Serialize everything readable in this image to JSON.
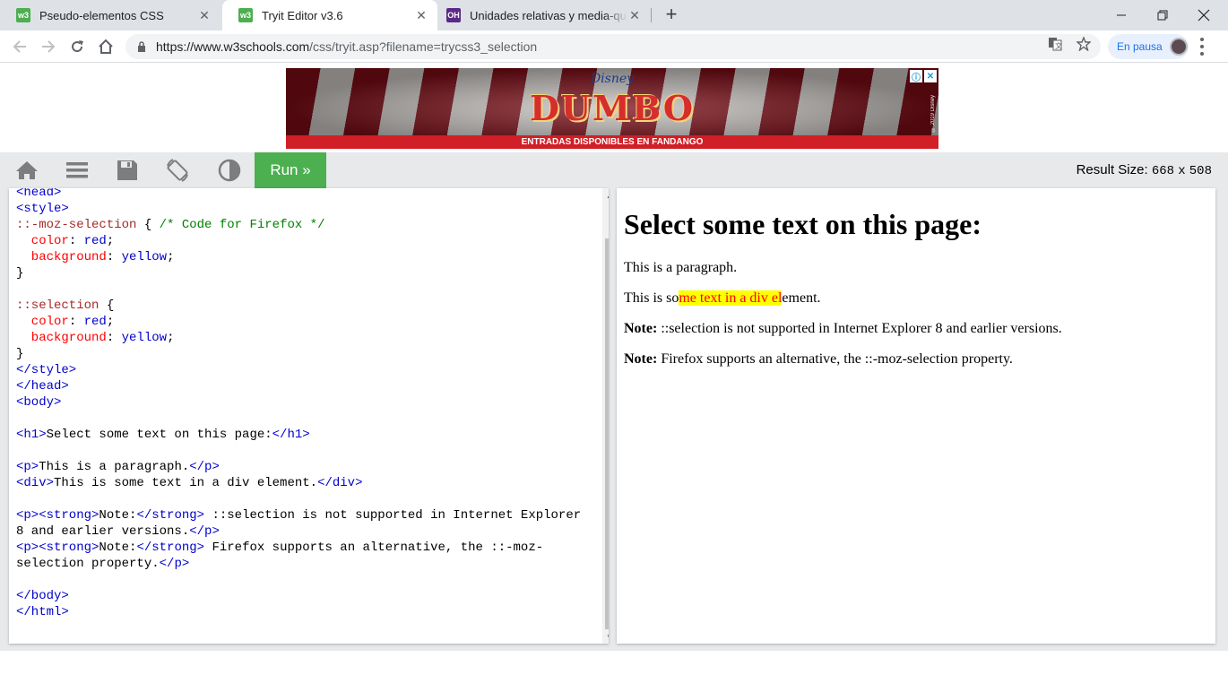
{
  "browser": {
    "tabs": [
      {
        "title": "Pseudo-elementos CSS",
        "favicon": "w3schools-icon",
        "active": false
      },
      {
        "title": "Tryit Editor v3.6",
        "favicon": "w3schools-icon",
        "active": true
      },
      {
        "title": "Unidades relativas y media-queries",
        "favicon": "openwebinars-icon",
        "active": false
      }
    ],
    "favicon_texts": [
      "w3",
      "w3",
      "OH"
    ],
    "close_glyph": "✕",
    "new_tab_glyph": "+",
    "url_host": "https://www.w3schools.com",
    "url_path": "/css/tryit.asp?filename=trycss3_selection",
    "profile_label": "En pausa",
    "colors": {
      "tabbar": "#dee1e6",
      "profile_accent": "#1a73e8"
    }
  },
  "ad": {
    "brand": "Disney",
    "movie": "DUMBO",
    "strip": "ENTRADAS DISPONIBLES EN FANDANGO",
    "copyright": "© 2019 Disney",
    "info_glyph": "ⓘ",
    "close_glyph": "✕"
  },
  "tryit": {
    "run_label": "Run »",
    "result_size_label": "Result Size:",
    "result_width": "668",
    "result_times": "x",
    "result_height": "508",
    "run_color": "#4caf50"
  },
  "editor": {
    "lines": [
      [
        {
          "t": "<head>",
          "c": "c-brack"
        }
      ],
      [
        {
          "t": "<style>",
          "c": "c-brack"
        }
      ],
      [
        {
          "t": "::-moz-selection",
          "c": "c-sel"
        },
        {
          "t": " { ",
          "c": "c-txt"
        },
        {
          "t": "/* Code for Firefox */",
          "c": "c-cmt"
        }
      ],
      [
        {
          "t": "  color",
          "c": "c-prop"
        },
        {
          "t": ": ",
          "c": "c-txt"
        },
        {
          "t": "red",
          "c": "c-val"
        },
        {
          "t": ";",
          "c": "c-txt"
        }
      ],
      [
        {
          "t": "  background",
          "c": "c-prop"
        },
        {
          "t": ": ",
          "c": "c-txt"
        },
        {
          "t": "yellow",
          "c": "c-val"
        },
        {
          "t": ";",
          "c": "c-txt"
        }
      ],
      [
        {
          "t": "}",
          "c": "c-txt"
        }
      ],
      [],
      [
        {
          "t": "::selection",
          "c": "c-sel"
        },
        {
          "t": " {",
          "c": "c-txt"
        }
      ],
      [
        {
          "t": "  color",
          "c": "c-prop"
        },
        {
          "t": ": ",
          "c": "c-txt"
        },
        {
          "t": "red",
          "c": "c-val"
        },
        {
          "t": ";",
          "c": "c-txt"
        }
      ],
      [
        {
          "t": "  background",
          "c": "c-prop"
        },
        {
          "t": ": ",
          "c": "c-txt"
        },
        {
          "t": "yellow",
          "c": "c-val"
        },
        {
          "t": ";",
          "c": "c-txt"
        }
      ],
      [
        {
          "t": "}",
          "c": "c-txt"
        }
      ],
      [
        {
          "t": "</style>",
          "c": "c-brack"
        }
      ],
      [
        {
          "t": "</head>",
          "c": "c-brack"
        }
      ],
      [
        {
          "t": "<body>",
          "c": "c-brack"
        }
      ],
      [],
      [
        {
          "t": "<h1>",
          "c": "c-brack"
        },
        {
          "t": "Select some text on this page:",
          "c": "c-txt"
        },
        {
          "t": "</h1>",
          "c": "c-brack"
        }
      ],
      [],
      [
        {
          "t": "<p>",
          "c": "c-brack"
        },
        {
          "t": "This is a paragraph.",
          "c": "c-txt"
        },
        {
          "t": "</p>",
          "c": "c-brack"
        }
      ],
      [
        {
          "t": "<div>",
          "c": "c-brack"
        },
        {
          "t": "This is some text in a div element.",
          "c": "c-txt"
        },
        {
          "t": "</div>",
          "c": "c-brack"
        }
      ],
      [],
      [
        {
          "t": "<p><strong>",
          "c": "c-brack"
        },
        {
          "t": "Note:",
          "c": "c-txt"
        },
        {
          "t": "</strong>",
          "c": "c-brack"
        },
        {
          "t": " ::selection is not supported in Internet Explorer",
          "c": "c-txt"
        }
      ],
      [
        {
          "t": "8 and earlier versions.",
          "c": "c-txt"
        },
        {
          "t": "</p>",
          "c": "c-brack"
        }
      ],
      [
        {
          "t": "<p><strong>",
          "c": "c-brack"
        },
        {
          "t": "Note:",
          "c": "c-txt"
        },
        {
          "t": "</strong>",
          "c": "c-brack"
        },
        {
          "t": " Firefox supports an alternative, the ::-moz-",
          "c": "c-txt"
        }
      ],
      [
        {
          "t": "selection property.",
          "c": "c-txt"
        },
        {
          "t": "</p>",
          "c": "c-brack"
        }
      ],
      [],
      [
        {
          "t": "</body>",
          "c": "c-brack"
        }
      ],
      [
        {
          "t": "</html>",
          "c": "c-brack"
        }
      ]
    ],
    "scroll_up_glyph": "▲",
    "scroll_down_glyph": "▼"
  },
  "result": {
    "heading": "Select some text on this page:",
    "p1": "This is a paragraph.",
    "div_before": "This is so",
    "div_selected": "me text in a div el",
    "div_after": "ement.",
    "note1_label": "Note:",
    "note1_text": " ::selection is not supported in Internet Explorer 8 and earlier versions.",
    "note2_label": "Note:",
    "note2_text": " Firefox supports an alternative, the ::-moz-selection property.",
    "selection_colors": {
      "background": "#ffff00",
      "color": "#ff0000"
    }
  }
}
